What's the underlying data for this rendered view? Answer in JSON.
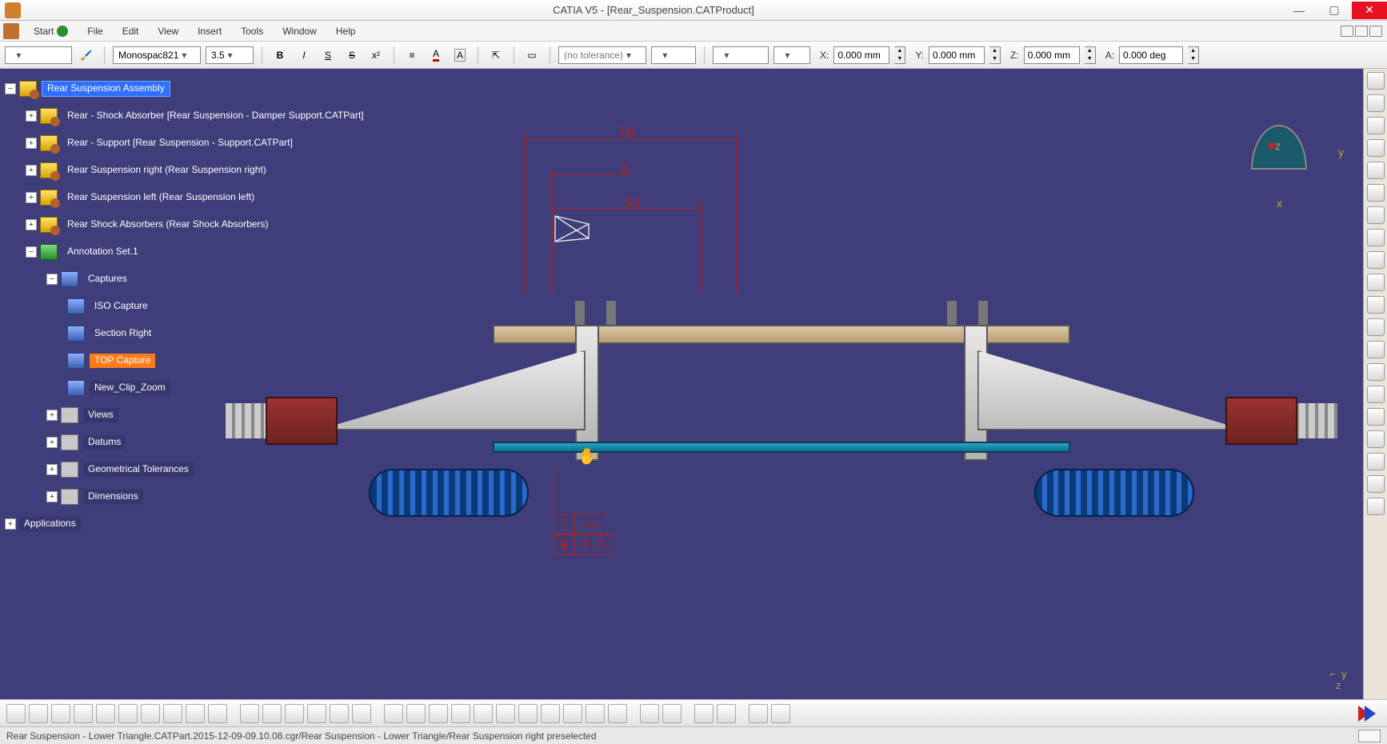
{
  "title": "CATIA V5 - [Rear_Suspension.CATProduct]",
  "menu": {
    "start": "Start",
    "file": "File",
    "edit": "Edit",
    "view": "View",
    "insert": "Insert",
    "tools": "Tools",
    "window": "Window",
    "help": "Help"
  },
  "fmt": {
    "font_name": "Monospac821",
    "font_size": "3.5",
    "tolerance": "(no tolerance)"
  },
  "coords": {
    "x_label": "X:",
    "x_val": "0.000 mm",
    "y_label": "Y:",
    "y_val": "0.000 mm",
    "z_label": "Z:",
    "z_val": "0.000 mm",
    "a_label": "A:",
    "a_val": "0.000 deg"
  },
  "tree": {
    "root": "Rear Suspension Assembly",
    "n1": "Rear - Shock Absorber [Rear Suspension - Damper Support.CATPart]",
    "n2": "Rear - Support [Rear Suspension - Support.CATPart]",
    "n3": "Rear Suspension right (Rear Suspension right)",
    "n4": "Rear Suspension left (Rear Suspension left)",
    "n5": "Rear Shock Absorbers (Rear Shock Absorbers)",
    "annot": "Annotation Set.1",
    "captures": "Captures",
    "cap1": "ISO Capture",
    "cap2": "Section Right",
    "cap3": "TOP Capture",
    "cap4": "New_Clip_Zoom",
    "views": "Views",
    "datums": "Datums",
    "geotol": "Geometrical Tolerances",
    "dims": "Dimensions",
    "apps": "Applications"
  },
  "dims_overlay": {
    "d1": "76",
    "d2": "4",
    "d3": "52",
    "tol1": "3.5",
    "tol1_sym": "⌀",
    "tol2": "0.5"
  },
  "compass": {
    "x": "x",
    "y": "y",
    "z": "z"
  },
  "status": "Rear Suspension - Lower Triangle.CATPart.2015-12-09-09.10.08.cgr/Rear Suspension - Lower Triangle/Rear Suspension right preselected"
}
